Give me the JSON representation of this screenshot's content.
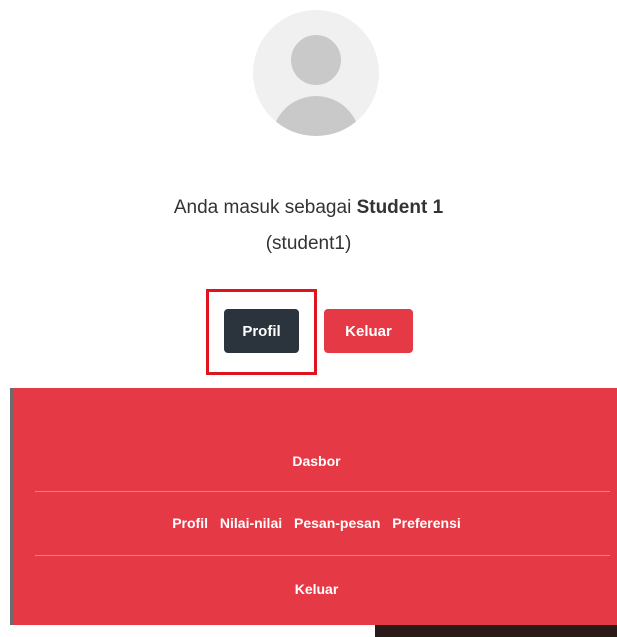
{
  "user": {
    "login_prefix": "Anda masuk sebagai",
    "display_name": "Student 1",
    "username": "(student1)"
  },
  "actions": {
    "profile_label": "Profil",
    "logout_label": "Keluar"
  },
  "menu": {
    "dashboard": "Dasbor",
    "links": [
      "Profil",
      "Nilai-nilai",
      "Pesan-pesan",
      "Preferensi"
    ],
    "logout": "Keluar"
  },
  "colors": {
    "accent": "#e63946",
    "dark_button": "#2b333c",
    "highlight": "#e0141e"
  },
  "icons": {
    "avatar": "user-avatar-icon"
  }
}
